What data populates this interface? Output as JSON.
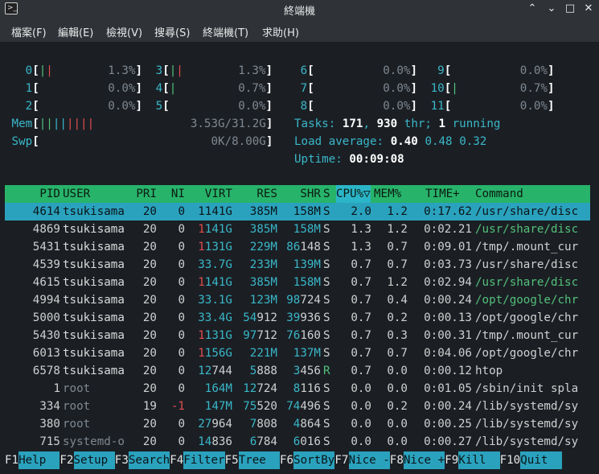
{
  "window": {
    "title": "終端機"
  },
  "menu": [
    "檔案(F)",
    "編輯(E)",
    "檢視(V)",
    "搜尋(S)",
    "終端機(T)",
    "求助(H)"
  ],
  "cpus": [
    {
      "id": "0",
      "bar": "||",
      "pct": "1.3%"
    },
    {
      "id": "1",
      "bar": "",
      "pct": "0.0%"
    },
    {
      "id": "2",
      "bar": "",
      "pct": "0.0%"
    },
    {
      "id": "3",
      "bar": "||",
      "pct": "1.3%"
    },
    {
      "id": "4",
      "bar": "|",
      "pct": "0.7%"
    },
    {
      "id": "5",
      "bar": "",
      "pct": "0.0%"
    },
    {
      "id": "6",
      "bar": "",
      "pct": "0.0%"
    },
    {
      "id": "7",
      "bar": "",
      "pct": "0.0%"
    },
    {
      "id": "8",
      "bar": "",
      "pct": "0.0%"
    },
    {
      "id": "9",
      "bar": "",
      "pct": "0.0%"
    },
    {
      "id": "10",
      "bar": "|",
      "pct": "0.7%"
    },
    {
      "id": "11",
      "bar": "",
      "pct": "0.0%"
    }
  ],
  "mem": {
    "label": "Mem",
    "bar": "||||||||",
    "value": "3.53G/31.2G"
  },
  "swp": {
    "label": "Swp",
    "value": "0K/8.00G"
  },
  "tasks": {
    "label": "Tasks:",
    "count": "171",
    "thr": "930",
    "thr_label": " thr;",
    "running": "1",
    "running_label": " running"
  },
  "load": {
    "label": "Load average:",
    "v1": "0.40",
    "v5": "0.48",
    "v15": "0.32"
  },
  "uptime": {
    "label": "Uptime:",
    "value": "00:09:08"
  },
  "columns": [
    "PID",
    "USER",
    "PRI",
    "NI",
    "VIRT",
    "RES",
    "SHR",
    "S",
    "CPU%▽",
    "MEM%",
    "TIME+",
    "Command"
  ],
  "processes": [
    {
      "pid": "4614",
      "user": "tsukisama",
      "pri": "20",
      "ni": "0",
      "virt": "1141G",
      "res": "385M",
      "shr": "158M",
      "s": "S",
      "cpu": "2.0",
      "mem": "1.2",
      "time": "0:17.62",
      "cmd": "/usr/share/disc",
      "selected": true
    },
    {
      "pid": "4869",
      "user": "tsukisama",
      "pri": "20",
      "ni": "0",
      "virt": "1141G",
      "res": "385M",
      "shr": "158M",
      "s": "S",
      "cpu": "1.3",
      "mem": "1.2",
      "time": "0:02.21",
      "cmd": "/usr/share/disc",
      "thread": true
    },
    {
      "pid": "5431",
      "user": "tsukisama",
      "pri": "20",
      "ni": "0",
      "virt": "1131G",
      "res": "229M",
      "shr": "86148",
      "s": "S",
      "cpu": "1.3",
      "mem": "0.7",
      "time": "0:09.01",
      "cmd": "/tmp/.mount_cur"
    },
    {
      "pid": "4539",
      "user": "tsukisama",
      "pri": "20",
      "ni": "0",
      "virt": "33.7G",
      "res": "233M",
      "shr": "139M",
      "s": "S",
      "cpu": "0.7",
      "mem": "0.7",
      "time": "0:03.73",
      "cmd": "/usr/share/disc"
    },
    {
      "pid": "4615",
      "user": "tsukisama",
      "pri": "20",
      "ni": "0",
      "virt": "1141G",
      "res": "385M",
      "shr": "158M",
      "s": "S",
      "cpu": "0.7",
      "mem": "1.2",
      "time": "0:02.94",
      "cmd": "/usr/share/disc",
      "thread": true
    },
    {
      "pid": "4994",
      "user": "tsukisama",
      "pri": "20",
      "ni": "0",
      "virt": "33.1G",
      "res": "123M",
      "shr": "98724",
      "s": "S",
      "cpu": "0.7",
      "mem": "0.4",
      "time": "0:00.24",
      "cmd": "/opt/google/chr",
      "thread": true
    },
    {
      "pid": "5000",
      "user": "tsukisama",
      "pri": "20",
      "ni": "0",
      "virt": "33.4G",
      "res": "54912",
      "shr": "39936",
      "s": "S",
      "cpu": "0.7",
      "mem": "0.2",
      "time": "0:00.13",
      "cmd": "/opt/google/chr"
    },
    {
      "pid": "5430",
      "user": "tsukisama",
      "pri": "20",
      "ni": "0",
      "virt": "1131G",
      "res": "97712",
      "shr": "76160",
      "s": "S",
      "cpu": "0.7",
      "mem": "0.3",
      "time": "0:00.31",
      "cmd": "/tmp/.mount_cur"
    },
    {
      "pid": "6013",
      "user": "tsukisama",
      "pri": "20",
      "ni": "0",
      "virt": "1156G",
      "res": "221M",
      "shr": "137M",
      "s": "S",
      "cpu": "0.7",
      "mem": "0.7",
      "time": "0:04.06",
      "cmd": "/opt/google/chr"
    },
    {
      "pid": "6578",
      "user": "tsukisama",
      "pri": "20",
      "ni": "0",
      "virt": "12744",
      "res": "5888",
      "shr": "3456",
      "s": "R",
      "cpu": "0.7",
      "mem": "0.0",
      "time": "0:00.12",
      "cmd": "htop"
    },
    {
      "pid": "1",
      "user": "root",
      "pri": "20",
      "ni": "0",
      "virt": "164M",
      "res": "12724",
      "shr": "8116",
      "s": "S",
      "cpu": "0.0",
      "mem": "0.0",
      "time": "0:01.05",
      "cmd": "/sbin/init spla"
    },
    {
      "pid": "334",
      "user": "root",
      "pri": "19",
      "ni": "-1",
      "virt": "147M",
      "res": "75520",
      "shr": "74496",
      "s": "S",
      "cpu": "0.0",
      "mem": "0.2",
      "time": "0:00.24",
      "cmd": "/lib/systemd/sy"
    },
    {
      "pid": "380",
      "user": "root",
      "pri": "20",
      "ni": "0",
      "virt": "27964",
      "res": "7808",
      "shr": "4864",
      "s": "S",
      "cpu": "0.0",
      "mem": "0.0",
      "time": "0:00.25",
      "cmd": "/lib/systemd/sy"
    },
    {
      "pid": "715",
      "user": "systemd-o",
      "pri": "20",
      "ni": "0",
      "virt": "14836",
      "res": "6784",
      "shr": "6016",
      "s": "S",
      "cpu": "0.0",
      "mem": "0.0",
      "time": "0:00.27",
      "cmd": "/lib/systemd/sy"
    }
  ],
  "fkeys": [
    {
      "key": "F1",
      "label": "Help"
    },
    {
      "key": "F2",
      "label": "Setup"
    },
    {
      "key": "F3",
      "label": "Search"
    },
    {
      "key": "F4",
      "label": "Filter"
    },
    {
      "key": "F5",
      "label": "Tree"
    },
    {
      "key": "F6",
      "label": "SortBy"
    },
    {
      "key": "F7",
      "label": "Nice -"
    },
    {
      "key": "F8",
      "label": "Nice +"
    },
    {
      "key": "F9",
      "label": "Kill"
    },
    {
      "key": "F10",
      "label": "Quit"
    }
  ],
  "colors": {
    "header_bg": "#27b36a",
    "select_bg": "#2aa2bd",
    "sorted_col_bg": "#2bb5c8",
    "bg": "#1b1f24"
  }
}
